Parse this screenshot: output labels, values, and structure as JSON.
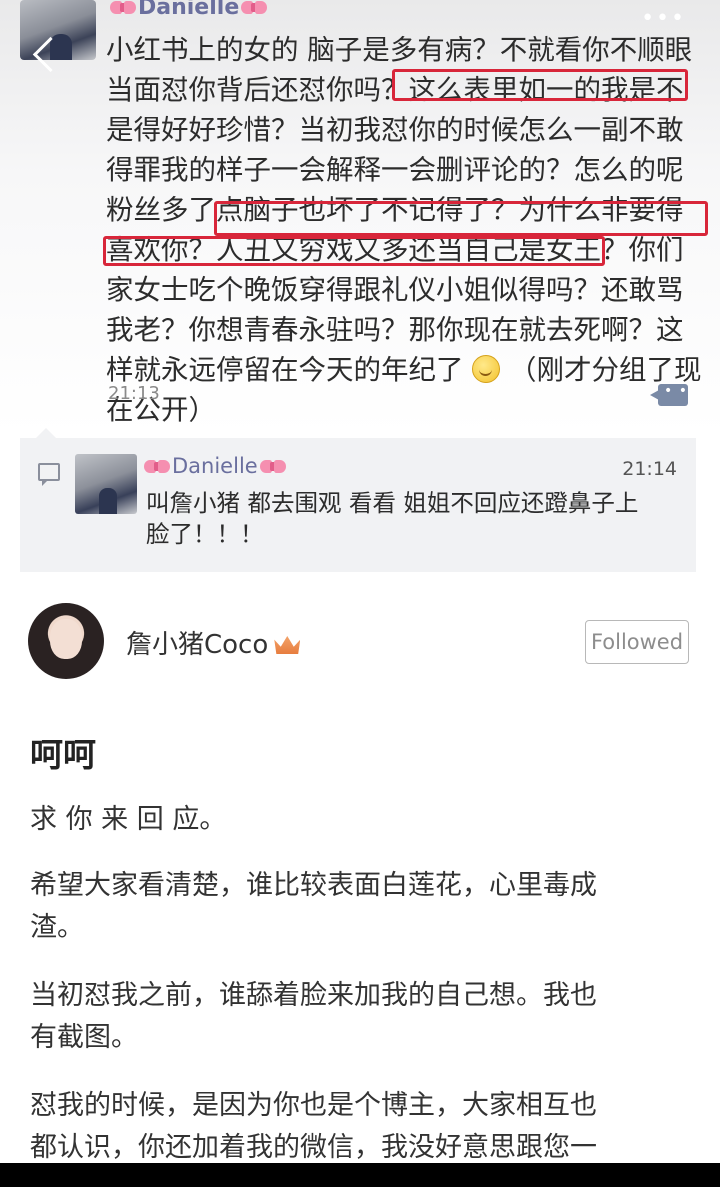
{
  "comment": {
    "author": "Danielle",
    "lines": [
      "小红书上的女的 脑子是多有病？不就看你不顺眼",
      "当面怼你背后还怼你吗？这么表里如一的我是不",
      "是得好好珍惜？当初我怼你的时候怎么一副不敢",
      "得罪我的样子一会解释一会删评论的？怎么的呢",
      "粉丝多了点脑子也坏了不记得了？为什么非要得",
      "喜欢你？人丑又穷戏又多还当自己是女王？你们",
      "家女士吃个晚饭穿得跟礼仪小姐似得吗？还敢骂",
      "我老？你想青春永驻吗？那你现在就去死啊？这",
      "样就永远停留在今天的年纪了",
      "（刚才分组了现",
      "在公开）"
    ],
    "time": "21:13",
    "emoji": "smile-emoji",
    "highlight_color": "#d8263a"
  },
  "reply": {
    "author": "Danielle",
    "time": "21:14",
    "lines": [
      "叫詹小猪 都去围观 看看 姐姐不回应还蹬鼻子上",
      "脸了！！！"
    ]
  },
  "post": {
    "author": "詹小猪Coco",
    "follow_label": "Followed",
    "title": "呵呵",
    "paragraphs": [
      {
        "lines": [
          "求 你 来 回 应。"
        ]
      },
      {
        "lines": [
          "希望大家看清楚，谁比较表面白莲花，心里毒成",
          "渣。"
        ]
      },
      {
        "lines": [
          "当初怼我之前，谁舔着脸来加我的自己想。我也",
          "有截图。"
        ]
      },
      {
        "lines": [
          "怼我的时候，是因为你也是个博主，大家相互也",
          "都认识，你还加着我的微信，我没好意思跟您一"
        ]
      }
    ]
  },
  "colors": {
    "name": "#6a6f9e",
    "bow": "#f58fb0",
    "reply_bg": "#f1f2f4"
  }
}
